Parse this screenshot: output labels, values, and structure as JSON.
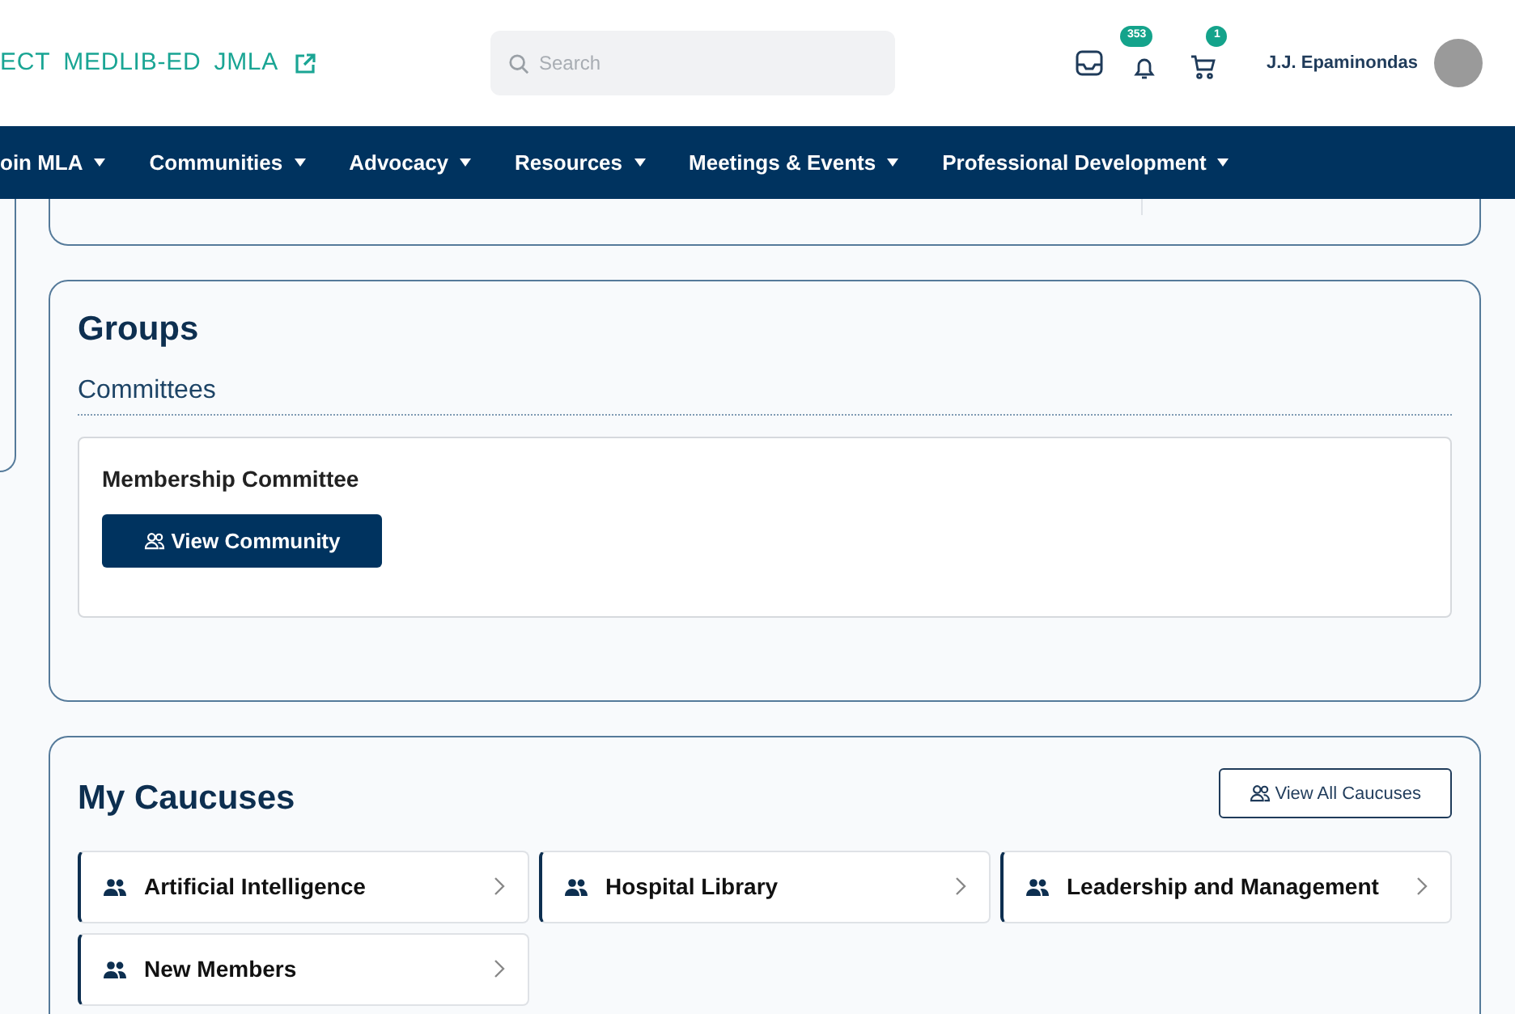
{
  "header": {
    "links": [
      "ECT",
      "MEDLIB-ED",
      "JMLA"
    ],
    "search": {
      "placeholder": "Search"
    },
    "notifications_badge": "353",
    "cart_badge": "1",
    "user_name": "J.J. Epaminondas"
  },
  "nav": [
    "oin MLA",
    "Communities",
    "Advocacy",
    "Resources",
    "Meetings & Events",
    "Professional Development"
  ],
  "groups": {
    "title": "Groups",
    "section": "Committees",
    "items": [
      {
        "name": "Membership Committee",
        "button": "View Community"
      }
    ]
  },
  "caucuses": {
    "title": "My Caucuses",
    "view_all": "View All Caucuses",
    "items": [
      "Artificial Intelligence",
      "Hospital Library",
      "Leadership and Management",
      "New Members"
    ]
  }
}
